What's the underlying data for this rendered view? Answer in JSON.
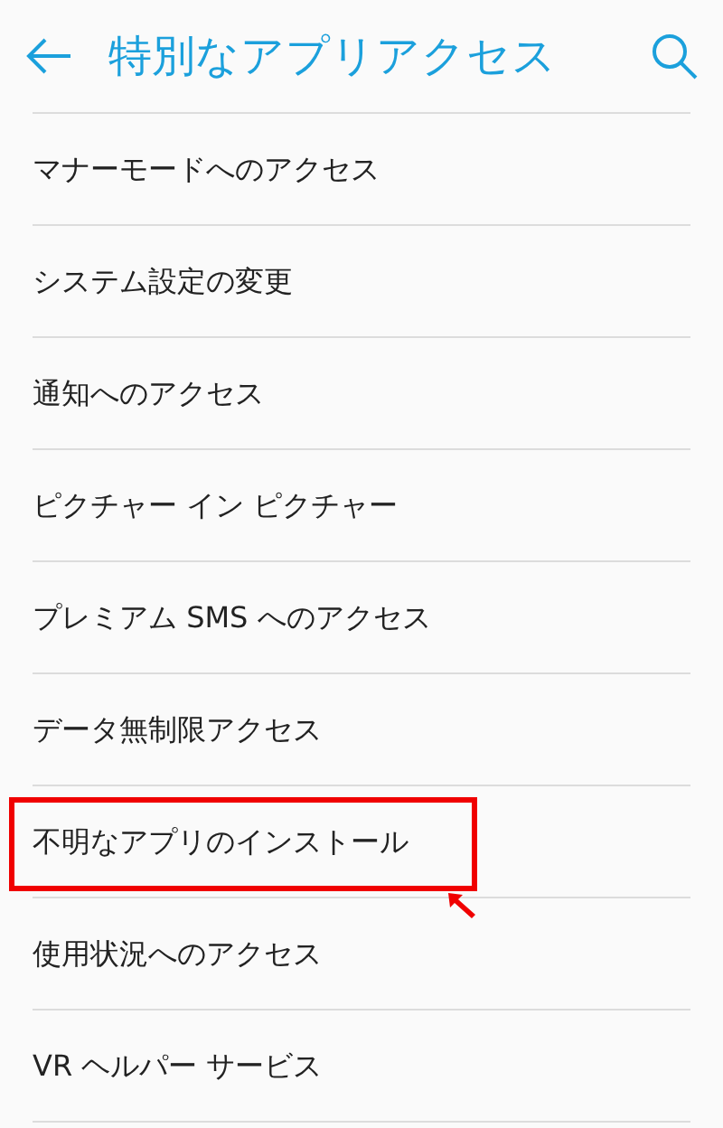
{
  "header": {
    "title": "特別なアプリアクセス"
  },
  "items": [
    {
      "label": "マナーモードへのアクセス",
      "highlighted": false
    },
    {
      "label": "システム設定の変更",
      "highlighted": false
    },
    {
      "label": "通知へのアクセス",
      "highlighted": false
    },
    {
      "label": "ピクチャー イン ピクチャー",
      "highlighted": false
    },
    {
      "label": "プレミアム SMS へのアクセス",
      "highlighted": false
    },
    {
      "label": "データ無制限アクセス",
      "highlighted": false
    },
    {
      "label": "不明なアプリのインストール",
      "highlighted": true
    },
    {
      "label": "使用状況へのアクセス",
      "highlighted": false
    },
    {
      "label": "VR ヘルパー サービス",
      "highlighted": false
    }
  ]
}
